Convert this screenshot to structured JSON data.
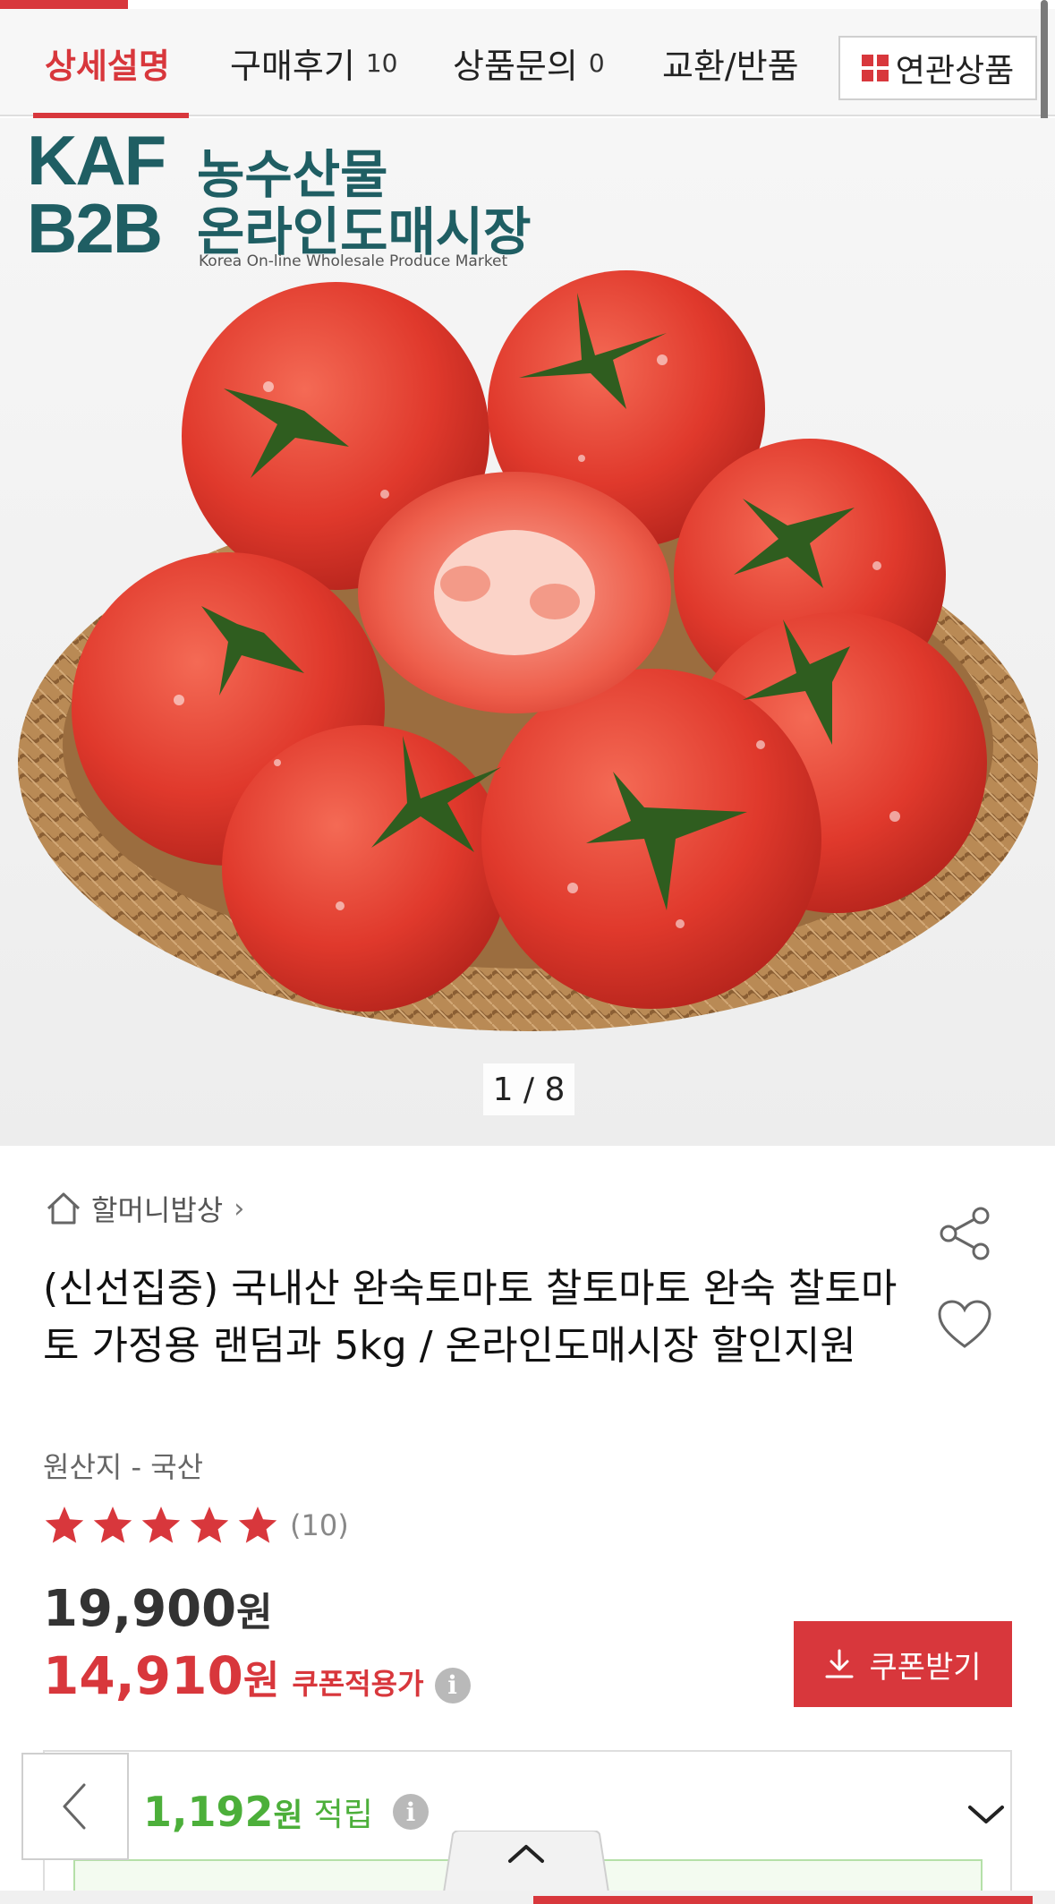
{
  "tabs": [
    {
      "label": "상세설명",
      "count": ""
    },
    {
      "label": "구매후기",
      "count": "10"
    },
    {
      "label": "상품문의",
      "count": "0"
    },
    {
      "label": "교환/반품",
      "count": ""
    }
  ],
  "related_label": "연관상품",
  "hero": {
    "logo_kaf": "KAF",
    "logo_b2b": "B2B",
    "logo_title_1": "농수산물",
    "logo_title_2": "온라인도매시장",
    "logo_subtitle": "Korea On-line Wholesale Produce Market",
    "counter": "1 / 8"
  },
  "product": {
    "store": "할머니밥상",
    "title": "(신선집중) 국내산 완숙토마토 찰토마토 완숙 찰토마토 가정용 랜덤과 5kg / 온라인도매시장 할인지원",
    "origin": "원산지 - 국산",
    "rating_stars": 5,
    "rating_count": "(10)",
    "price_original": "19,900",
    "price_sale": "14,910",
    "currency": "원",
    "coupon_price_label": "쿠폰적용가",
    "coupon_button": "쿠폰받기",
    "points": "1,192",
    "points_label": "적립"
  },
  "icons": {
    "home": "home-icon",
    "share": "share-icon",
    "heart": "heart-icon",
    "download": "download-icon",
    "info": "info-icon",
    "chevron_down": "chevron-down-icon",
    "back": "chevron-left-icon",
    "up": "chevron-up-icon"
  },
  "colors": {
    "accent": "#d8373c",
    "points_green": "#4caf3a",
    "logo_teal": "#1f5e63"
  }
}
